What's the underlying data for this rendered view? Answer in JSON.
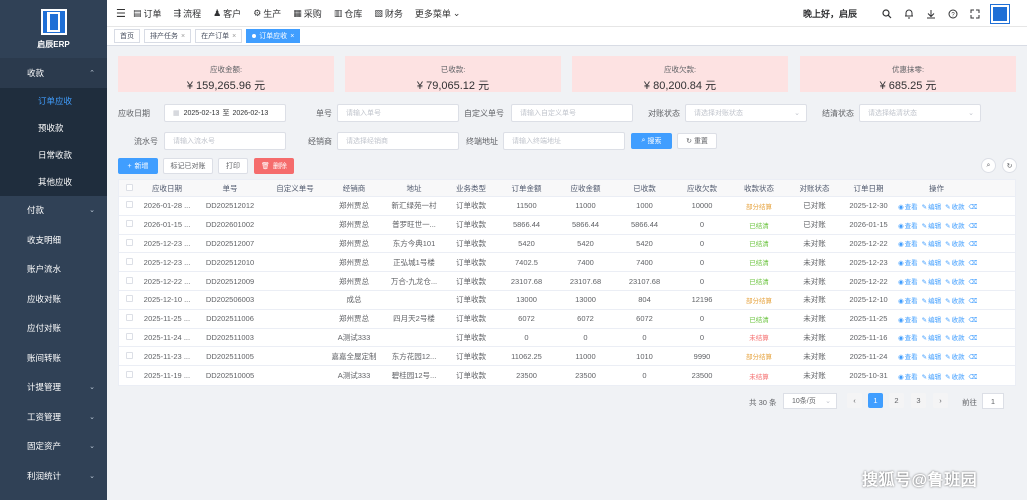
{
  "app": {
    "logo_text": "启辰ERP"
  },
  "sidebar": {
    "sections": [
      {
        "label": "收款",
        "arrow": "⌃",
        "open": true,
        "items": [
          {
            "label": "订单应收",
            "active": true
          },
          {
            "label": "预收款"
          },
          {
            "label": "日常收款"
          },
          {
            "label": "其他应收"
          }
        ]
      },
      {
        "label": "付款",
        "arrow": "⌄"
      },
      {
        "label": "收支明细"
      },
      {
        "label": "账户流水"
      },
      {
        "label": "应收对账"
      },
      {
        "label": "应付对账"
      },
      {
        "label": "账间转账"
      },
      {
        "label": "计提管理",
        "arrow": "⌄"
      },
      {
        "label": "工资管理",
        "arrow": "⌄"
      },
      {
        "label": "固定资产",
        "arrow": "⌄"
      },
      {
        "label": "利润统计",
        "arrow": "⌄"
      }
    ]
  },
  "header": {
    "nav": [
      {
        "label": "订单",
        "icon": "document-icon"
      },
      {
        "label": "流程",
        "icon": "flow-icon"
      },
      {
        "label": "客户",
        "icon": "user-icon"
      },
      {
        "label": "生产",
        "icon": "gear-icon"
      },
      {
        "label": "采购",
        "icon": "cart-icon"
      },
      {
        "label": "仓库",
        "icon": "warehouse-icon"
      },
      {
        "label": "财务",
        "icon": "finance-icon"
      }
    ],
    "more": "更多菜单",
    "greeting": "晚上好，启辰"
  },
  "tags": [
    {
      "label": "首页"
    },
    {
      "label": "排产任务",
      "close": "×"
    },
    {
      "label": "在产订单",
      "close": "×"
    },
    {
      "label": "订单应收",
      "close": "×",
      "active": true
    }
  ],
  "stats": [
    {
      "label": "应收金额:",
      "value": "¥ 159,265.96 元"
    },
    {
      "label": "已收款:",
      "value": "¥ 79,065.12 元"
    },
    {
      "label": "应收欠款:",
      "value": "¥ 80,200.84 元"
    },
    {
      "label": "优惠抹零:",
      "value": "¥ 685.25 元"
    }
  ],
  "filters": {
    "date_label": "应收日期",
    "date_start": "2025-02-13",
    "date_sep": "至",
    "date_end": "2026-02-13",
    "order_no_label": "单号",
    "order_no_ph": "请输入单号",
    "custom_no_label": "自定义单号",
    "custom_no_ph": "请输入自定义单号",
    "reconcile_label": "对账状态",
    "reconcile_ph": "请选择对账状态",
    "settle_label": "结清状态",
    "settle_ph": "请选择结清状态",
    "serial_label": "流水号",
    "serial_ph": "请输入流水号",
    "dealer_label": "经销商",
    "dealer_ph": "请选择经销商",
    "terminal_label": "终端地址",
    "terminal_ph": "请输入终端地址",
    "search_btn": "搜索",
    "reset_btn": "重置"
  },
  "toolbar": {
    "add": "新增",
    "mark": "标记已对账",
    "print": "打印",
    "delete": "删除"
  },
  "table": {
    "columns": [
      "应收日期",
      "单号",
      "自定义单号",
      "经销商",
      "地址",
      "业务类型",
      "订单金额",
      "应收金额",
      "已收款",
      "应收欠款",
      "收款状态",
      "对账状态",
      "订单日期",
      "操作"
    ],
    "ops": [
      "查看",
      "编辑",
      "收款",
      "删除"
    ],
    "rows": [
      [
        "2026-01-28 ...",
        "DD202512012",
        "",
        "郑州贾总",
        "新汇绿苑一村",
        "订单收款",
        "11500",
        "11000",
        "1000",
        "10000",
        "部分结算",
        "已对账",
        "2025-12-30"
      ],
      [
        "2026-01-15 ...",
        "DD202601002",
        "",
        "郑州贾总",
        "普罗旺世一...",
        "订单收款",
        "5866.44",
        "5866.44",
        "5866.44",
        "0",
        "已结清",
        "已对账",
        "2026-01-15"
      ],
      [
        "2025-12-23 ...",
        "DD202512007",
        "",
        "郑州贾总",
        "东方今典101",
        "订单收款",
        "5420",
        "5420",
        "5420",
        "0",
        "已结清",
        "未对账",
        "2025-12-22"
      ],
      [
        "2025-12-23 ...",
        "DD202512010",
        "",
        "郑州贾总",
        "正弘城1号楼",
        "订单收款",
        "7402.5",
        "7400",
        "7400",
        "0",
        "已结清",
        "未对账",
        "2025-12-23"
      ],
      [
        "2025-12-22 ...",
        "DD202512009",
        "",
        "郑州贾总",
        "万合-九龙仓...",
        "订单收款",
        "23107.68",
        "23107.68",
        "23107.68",
        "0",
        "已结清",
        "未对账",
        "2025-12-22"
      ],
      [
        "2025-12-10 ...",
        "DD202506003",
        "",
        "成总",
        "",
        "订单收款",
        "13000",
        "13000",
        "804",
        "12196",
        "部分结算",
        "未对账",
        "2025-12-10"
      ],
      [
        "2025-11-25 ...",
        "DD202511006",
        "",
        "郑州贾总",
        "四月天2号楼",
        "订单收款",
        "6072",
        "6072",
        "6072",
        "0",
        "已结清",
        "未对账",
        "2025-11-25"
      ],
      [
        "2025-11-24 ...",
        "DD202511003",
        "",
        "A测试333",
        "",
        "订单收款",
        "0",
        "0",
        "0",
        "0",
        "未结算",
        "未对账",
        "2025-11-16"
      ],
      [
        "2025-11-23 ...",
        "DD202511005",
        "",
        "嘉嘉全屋定制",
        "东方花园12...",
        "订单收款",
        "11062.25",
        "11000",
        "1010",
        "9990",
        "部分结算",
        "未对账",
        "2025-11-24"
      ],
      [
        "2025-11-19 ...",
        "DD202510005",
        "",
        "A测试333",
        "碧桂园12号...",
        "订单收款",
        "23500",
        "23500",
        "0",
        "23500",
        "未结算",
        "未对账",
        "2025-10-31"
      ]
    ]
  },
  "pagination": {
    "total": "共 30 条",
    "page_size": "10条/页",
    "prev": "‹",
    "pages": [
      "1",
      "2",
      "3"
    ],
    "next": "›",
    "goto_label": "前往",
    "goto_value": "1"
  },
  "watermark": "搜狐号@鲁班园"
}
